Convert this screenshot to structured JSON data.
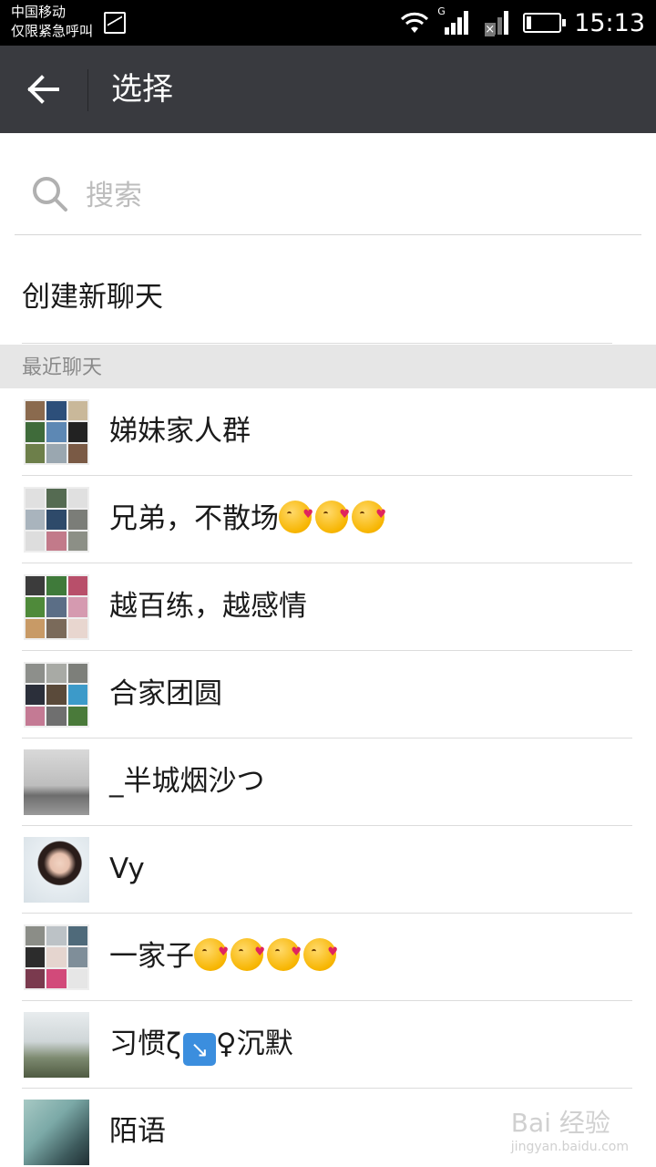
{
  "status_bar": {
    "carrier_line1": "中国移动",
    "carrier_line2": "仅限紧急呼叫",
    "network_label": "G",
    "time": "15:13"
  },
  "app_bar": {
    "title": "选择",
    "back_icon": "arrow-left-icon",
    "bg_color": "#393a3f"
  },
  "search": {
    "placeholder": "搜索",
    "icon": "search-icon"
  },
  "create_chat": {
    "label": "创建新聊天"
  },
  "recent": {
    "header": "最近聊天",
    "items": [
      {
        "name": "娣妹家人群"
      },
      {
        "name": "兄弟，不散场",
        "emoji": "kissing-face-emoji x3"
      },
      {
        "name": "越百练，越感情"
      },
      {
        "name": "合家团圆"
      },
      {
        "name": "_半城烟沙つ"
      },
      {
        "name": "Vy"
      },
      {
        "name": "一家子",
        "emoji": "kissing-face-emoji x4"
      },
      {
        "name_prefix": "习惯ζ",
        "name_suffix": "♀沉默",
        "emoji": "arrow-down-right-emoji"
      },
      {
        "name": "陌语"
      }
    ]
  },
  "watermark": {
    "brand": "Bai 经验",
    "url": "jingyan.baidu.com"
  }
}
